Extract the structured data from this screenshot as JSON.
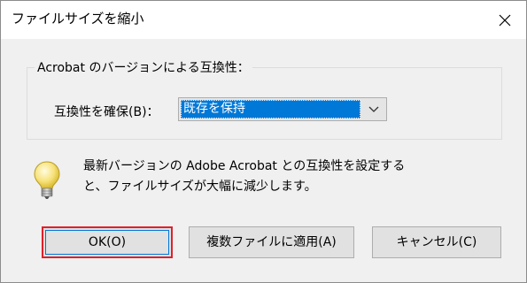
{
  "window": {
    "title": "ファイルサイズを縮小"
  },
  "compat_group": {
    "legend": "Acrobat のバージョンによる互換性：",
    "label": "互換性を確保(B)：",
    "selected": "既存を保持"
  },
  "info": {
    "icon": "lightbulb-icon",
    "line1": "最新バージョンの Adobe Acrobat との互換性を設定する",
    "line2": "と、ファイルサイズが大幅に減少します。"
  },
  "buttons": {
    "ok": "OK(O)",
    "apply_multiple": "複数ファイルに適用(A)",
    "cancel": "キャンセル(C)"
  },
  "colors": {
    "selection": "#0078d7",
    "highlight_box": "#e0202a"
  }
}
